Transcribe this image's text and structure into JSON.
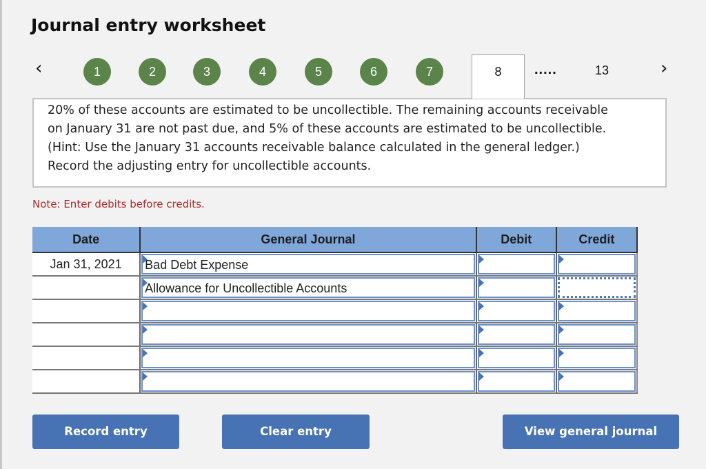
{
  "title": "Journal entry worksheet",
  "navigation": {
    "prev_icon": "‹",
    "next_icon": "›",
    "completed_steps": [
      "1",
      "2",
      "3",
      "4",
      "5",
      "6",
      "7"
    ],
    "current_step": "8",
    "ellipsis": ".....",
    "last_step": "13",
    "step_color": "#5a8449"
  },
  "question": {
    "text": "20% of these accounts are estimated to be uncollectible. The remaining accounts receivable on January 31 are not past due, and 5% of these accounts are estimated to be uncollectible. (Hint: Use the January 31 accounts receivable balance calculated in the general ledger.) Record the adjusting entry for uncollectible accounts."
  },
  "note": "Note: Enter debits before credits.",
  "journal": {
    "headers": {
      "date": "Date",
      "account": "General Journal",
      "debit": "Debit",
      "credit": "Credit"
    },
    "rows": [
      {
        "date": "Jan 31, 2021",
        "account": "Bad Debt Expense",
        "debit": "",
        "credit": ""
      },
      {
        "date": "",
        "account": "Allowance for Uncollectible Accounts",
        "debit": "",
        "credit": ""
      },
      {
        "date": "",
        "account": "",
        "debit": "",
        "credit": ""
      },
      {
        "date": "",
        "account": "",
        "debit": "",
        "credit": ""
      },
      {
        "date": "",
        "account": "",
        "debit": "",
        "credit": ""
      },
      {
        "date": "",
        "account": "",
        "debit": "",
        "credit": ""
      }
    ],
    "focused_cell": "row-2-credit",
    "header_color": "#7fa7d9"
  },
  "buttons": {
    "record": "Record entry",
    "clear": "Clear entry",
    "view": "View general journal",
    "color": "#4773b5"
  }
}
